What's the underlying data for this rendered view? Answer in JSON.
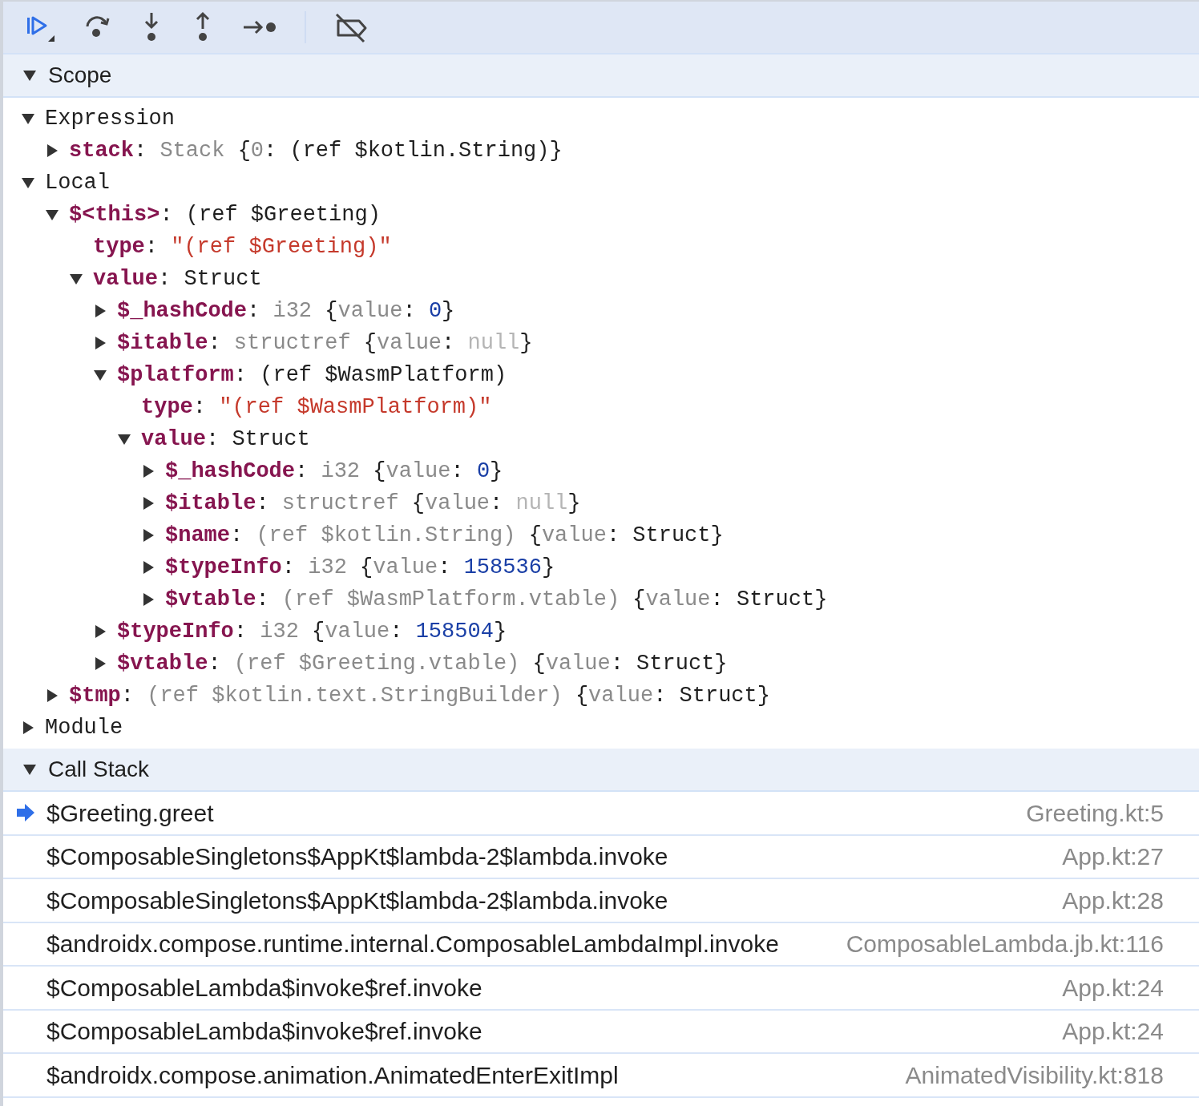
{
  "scope": {
    "title": "Scope",
    "expanded": true,
    "tree": [
      {
        "kind": "section",
        "name": "Expression",
        "expanded": true,
        "children": [
          {
            "kind": "property",
            "name": "stack",
            "separator": ": ",
            "expanded": false,
            "value": [
              {
                "kind": "dim",
                "text": "Stack"
              },
              {
                "kind": "plain",
                "text": " {"
              },
              {
                "kind": "dim",
                "text": "0"
              },
              {
                "kind": "plain",
                "text": ": (ref $kotlin.String)}"
              }
            ]
          }
        ]
      },
      {
        "kind": "section",
        "name": "Local",
        "expanded": true,
        "children": [
          {
            "kind": "property",
            "name": "$<this>",
            "separator": ": ",
            "expanded": true,
            "value": [
              {
                "kind": "plain",
                "text": "(ref $Greeting)"
              }
            ],
            "children": [
              {
                "kind": "leaf",
                "name": "type",
                "separator": ": ",
                "value": [
                  {
                    "kind": "string",
                    "text": "\"(ref $Greeting)\""
                  }
                ]
              },
              {
                "kind": "property",
                "name": "value",
                "separator": ": ",
                "expanded": true,
                "value": [
                  {
                    "kind": "plain",
                    "text": "Struct"
                  }
                ],
                "children": [
                  {
                    "kind": "property",
                    "name": "$_hashCode",
                    "separator": ": ",
                    "expanded": false,
                    "value": [
                      {
                        "kind": "dim",
                        "text": "i32"
                      },
                      {
                        "kind": "plain",
                        "text": " {"
                      },
                      {
                        "kind": "dim",
                        "text": "value"
                      },
                      {
                        "kind": "plain",
                        "text": ": "
                      },
                      {
                        "kind": "number",
                        "text": "0"
                      },
                      {
                        "kind": "plain",
                        "text": "}"
                      }
                    ]
                  },
                  {
                    "kind": "property",
                    "name": "$itable",
                    "separator": ": ",
                    "expanded": false,
                    "value": [
                      {
                        "kind": "dim",
                        "text": "structref"
                      },
                      {
                        "kind": "plain",
                        "text": " {"
                      },
                      {
                        "kind": "dim",
                        "text": "value"
                      },
                      {
                        "kind": "plain",
                        "text": ": "
                      },
                      {
                        "kind": "null",
                        "text": "null"
                      },
                      {
                        "kind": "plain",
                        "text": "}"
                      }
                    ]
                  },
                  {
                    "kind": "property",
                    "name": "$platform",
                    "separator": ": ",
                    "expanded": true,
                    "value": [
                      {
                        "kind": "plain",
                        "text": "(ref $WasmPlatform)"
                      }
                    ],
                    "children": [
                      {
                        "kind": "leaf",
                        "name": "type",
                        "separator": ": ",
                        "value": [
                          {
                            "kind": "string",
                            "text": "\"(ref $WasmPlatform)\""
                          }
                        ]
                      },
                      {
                        "kind": "property",
                        "name": "value",
                        "separator": ": ",
                        "expanded": true,
                        "value": [
                          {
                            "kind": "plain",
                            "text": "Struct"
                          }
                        ],
                        "children": [
                          {
                            "kind": "property",
                            "name": "$_hashCode",
                            "separator": ": ",
                            "expanded": false,
                            "value": [
                              {
                                "kind": "dim",
                                "text": "i32"
                              },
                              {
                                "kind": "plain",
                                "text": " {"
                              },
                              {
                                "kind": "dim",
                                "text": "value"
                              },
                              {
                                "kind": "plain",
                                "text": ": "
                              },
                              {
                                "kind": "number",
                                "text": "0"
                              },
                              {
                                "kind": "plain",
                                "text": "}"
                              }
                            ]
                          },
                          {
                            "kind": "property",
                            "name": "$itable",
                            "separator": ": ",
                            "expanded": false,
                            "value": [
                              {
                                "kind": "dim",
                                "text": "structref"
                              },
                              {
                                "kind": "plain",
                                "text": " {"
                              },
                              {
                                "kind": "dim",
                                "text": "value"
                              },
                              {
                                "kind": "plain",
                                "text": ": "
                              },
                              {
                                "kind": "null",
                                "text": "null"
                              },
                              {
                                "kind": "plain",
                                "text": "}"
                              }
                            ]
                          },
                          {
                            "kind": "property",
                            "name": "$name",
                            "separator": ": ",
                            "expanded": false,
                            "value": [
                              {
                                "kind": "dim",
                                "text": "(ref $kotlin.String)"
                              },
                              {
                                "kind": "plain",
                                "text": " {"
                              },
                              {
                                "kind": "dim",
                                "text": "value"
                              },
                              {
                                "kind": "plain",
                                "text": ": Struct}"
                              }
                            ]
                          },
                          {
                            "kind": "property",
                            "name": "$typeInfo",
                            "separator": ": ",
                            "expanded": false,
                            "value": [
                              {
                                "kind": "dim",
                                "text": "i32"
                              },
                              {
                                "kind": "plain",
                                "text": " {"
                              },
                              {
                                "kind": "dim",
                                "text": "value"
                              },
                              {
                                "kind": "plain",
                                "text": ": "
                              },
                              {
                                "kind": "number",
                                "text": "158536"
                              },
                              {
                                "kind": "plain",
                                "text": "}"
                              }
                            ]
                          },
                          {
                            "kind": "property",
                            "name": "$vtable",
                            "separator": ": ",
                            "expanded": false,
                            "value": [
                              {
                                "kind": "dim",
                                "text": "(ref $WasmPlatform.vtable)"
                              },
                              {
                                "kind": "plain",
                                "text": " {"
                              },
                              {
                                "kind": "dim",
                                "text": "value"
                              },
                              {
                                "kind": "plain",
                                "text": ": Struct}"
                              }
                            ]
                          }
                        ]
                      }
                    ]
                  },
                  {
                    "kind": "property",
                    "name": "$typeInfo",
                    "separator": ": ",
                    "expanded": false,
                    "value": [
                      {
                        "kind": "dim",
                        "text": "i32"
                      },
                      {
                        "kind": "plain",
                        "text": " {"
                      },
                      {
                        "kind": "dim",
                        "text": "value"
                      },
                      {
                        "kind": "plain",
                        "text": ": "
                      },
                      {
                        "kind": "number",
                        "text": "158504"
                      },
                      {
                        "kind": "plain",
                        "text": "}"
                      }
                    ]
                  },
                  {
                    "kind": "property",
                    "name": "$vtable",
                    "separator": ": ",
                    "expanded": false,
                    "value": [
                      {
                        "kind": "dim",
                        "text": "(ref $Greeting.vtable)"
                      },
                      {
                        "kind": "plain",
                        "text": " {"
                      },
                      {
                        "kind": "dim",
                        "text": "value"
                      },
                      {
                        "kind": "plain",
                        "text": ": Struct}"
                      }
                    ]
                  }
                ]
              }
            ]
          },
          {
            "kind": "property",
            "name": "$tmp",
            "separator": ": ",
            "expanded": false,
            "value": [
              {
                "kind": "dim",
                "text": "(ref $kotlin.text.StringBuilder)"
              },
              {
                "kind": "plain",
                "text": " {"
              },
              {
                "kind": "dim",
                "text": "value"
              },
              {
                "kind": "plain",
                "text": ": Struct}"
              }
            ]
          }
        ]
      },
      {
        "kind": "section",
        "name": "Module",
        "expanded": false
      }
    ]
  },
  "call_stack": {
    "title": "Call Stack",
    "expanded": true,
    "frames": [
      {
        "function": "$Greeting.greet",
        "location": "Greeting.kt:5",
        "selected": true
      },
      {
        "function": "$ComposableSingletons$AppKt$lambda-2$lambda.invoke",
        "location": "App.kt:27",
        "selected": false
      },
      {
        "function": "$ComposableSingletons$AppKt$lambda-2$lambda.invoke",
        "location": "App.kt:28",
        "selected": false
      },
      {
        "function": "$androidx.compose.runtime.internal.ComposableLambdaImpl.invoke",
        "location": "ComposableLambda.jb.kt:116",
        "selected": false
      },
      {
        "function": "$ComposableLambda$invoke$ref.invoke",
        "location": "App.kt:24",
        "selected": false
      },
      {
        "function": "$ComposableLambda$invoke$ref.invoke",
        "location": "App.kt:24",
        "selected": false
      },
      {
        "function": "$androidx.compose.animation.AnimatedEnterExitImpl",
        "location": "AnimatedVisibility.kt:818",
        "selected": false
      }
    ]
  }
}
